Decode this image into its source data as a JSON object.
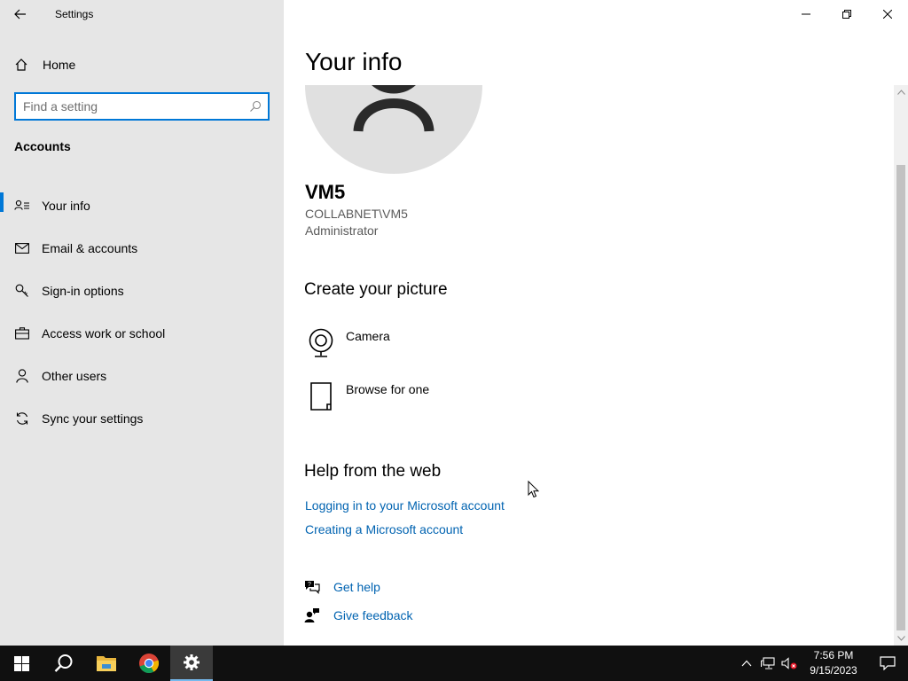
{
  "window": {
    "title": "Settings"
  },
  "sidebar": {
    "home_label": "Home",
    "search_placeholder": "Find a setting",
    "section_title": "Accounts",
    "items": [
      {
        "label": "Your info",
        "icon": "contact-info-icon",
        "active": true
      },
      {
        "label": "Email & accounts",
        "icon": "mail-icon",
        "active": false
      },
      {
        "label": "Sign-in options",
        "icon": "key-icon",
        "active": false
      },
      {
        "label": "Access work or school",
        "icon": "briefcase-icon",
        "active": false
      },
      {
        "label": "Other users",
        "icon": "person-icon",
        "active": false
      },
      {
        "label": "Sync your settings",
        "icon": "sync-icon",
        "active": false
      }
    ]
  },
  "main": {
    "page_title": "Your info",
    "user": {
      "name": "VM5",
      "domain": "COLLABNET\\VM5",
      "role": "Administrator"
    },
    "create_picture": {
      "heading": "Create your picture",
      "options": [
        {
          "label": "Camera",
          "icon": "camera-icon"
        },
        {
          "label": "Browse for one",
          "icon": "document-icon"
        }
      ]
    },
    "help": {
      "heading": "Help from the web",
      "links": [
        "Logging in to your Microsoft account",
        "Creating a Microsoft account"
      ]
    },
    "support": {
      "get_help": "Get help",
      "give_feedback": "Give feedback"
    }
  },
  "taskbar": {
    "time": "7:56 PM",
    "date": "9/15/2023"
  },
  "colors": {
    "accent": "#0078d7",
    "link": "#0063b1",
    "sidebar_bg": "#e6e6e6",
    "taskbar_bg": "#101010"
  }
}
